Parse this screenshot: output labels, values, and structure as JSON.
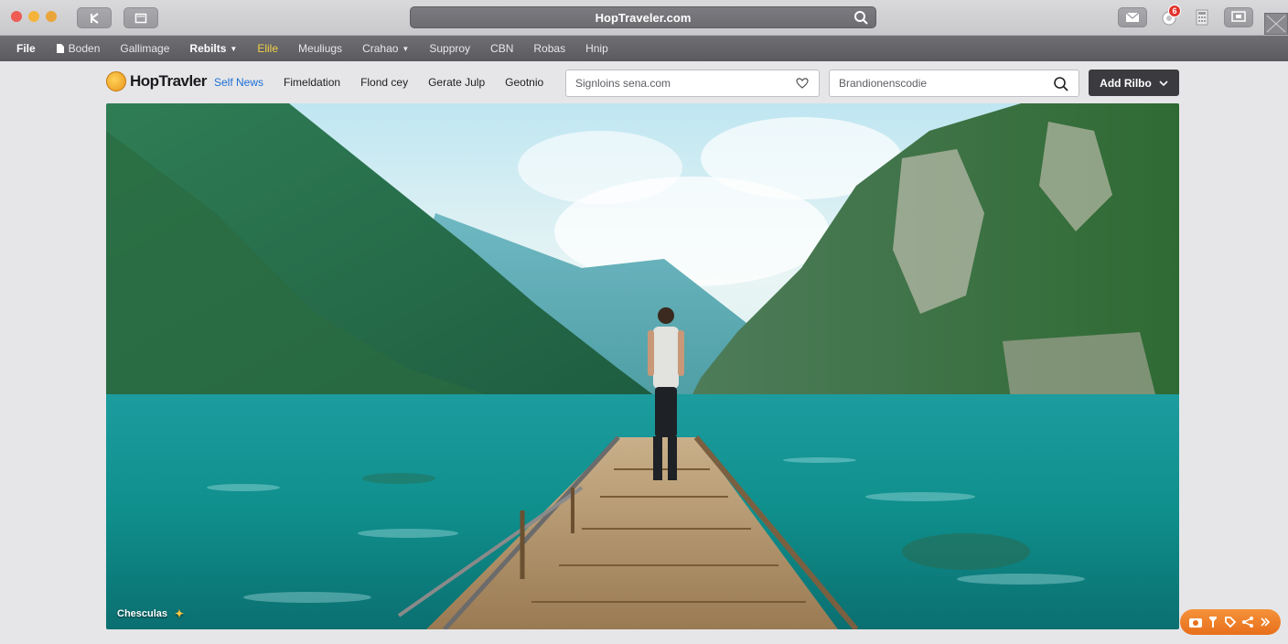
{
  "window": {
    "address": "HopTraveler.com"
  },
  "menubar": {
    "items": [
      {
        "label": "File",
        "style": "bold"
      },
      {
        "label": "Boden",
        "icon": "file-icon"
      },
      {
        "label": "Gallimage"
      },
      {
        "label": "Rebilts",
        "style": "bold",
        "has_caret": true
      },
      {
        "label": "Elile",
        "style": "active"
      },
      {
        "label": "Meuliugs"
      },
      {
        "label": "Crahao",
        "has_caret": true
      },
      {
        "label": "Supproy"
      },
      {
        "label": "CBN"
      },
      {
        "label": "Robas"
      },
      {
        "label": "Hnip"
      }
    ]
  },
  "notifications": {
    "count": "6"
  },
  "site": {
    "logo_text": "HopTravler",
    "nav": [
      {
        "label": "Self News",
        "active": true
      },
      {
        "label": "Fimeldation"
      },
      {
        "label": "Flond cey"
      },
      {
        "label": "Gerate Julp"
      },
      {
        "label": "Geotnio"
      }
    ],
    "field_1": {
      "value": "Signloins sena.com"
    },
    "field_2": {
      "value": "Brandionenscodie"
    },
    "add_button": "Add Rilbo"
  },
  "hero": {
    "caption": "Chesculas",
    "caption_icon": "sparkle-icon"
  },
  "colors": {
    "accent": "#1c6fd6",
    "menu_active": "#f2d048",
    "float_toolbar": "#e86f1c",
    "notification_badge": "#e0322a"
  }
}
